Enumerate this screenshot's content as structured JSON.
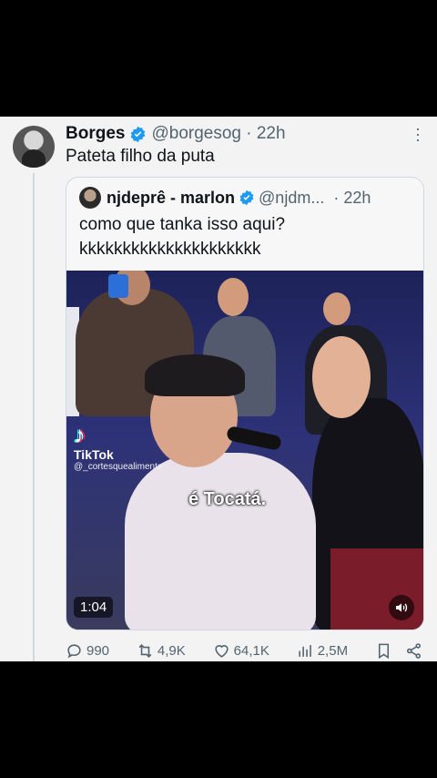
{
  "tweet": {
    "author_name": "Borges",
    "handle_time": "@borgesog · 22h",
    "text": "Pateta filho da puta"
  },
  "quote": {
    "author_name": "njdeprê - marlon",
    "handle": "@njdm...",
    "time": "· 22h",
    "text_line1": "como que tanka isso aqui?",
    "text_line2": "kkkkkkkkkkkkkkkkkkkkk"
  },
  "media": {
    "tiktok_label": "TikTok",
    "tiktok_user": "@_cortesquealimenta",
    "caption": "é Tocatá.",
    "duration": "1:04"
  },
  "actions": {
    "replies": "990",
    "reposts": "4,9K",
    "likes": "64,1K",
    "views": "2,5M"
  },
  "colors": {
    "verified": "#1d9bf0",
    "text": "#0f1419",
    "muted": "#536471"
  }
}
